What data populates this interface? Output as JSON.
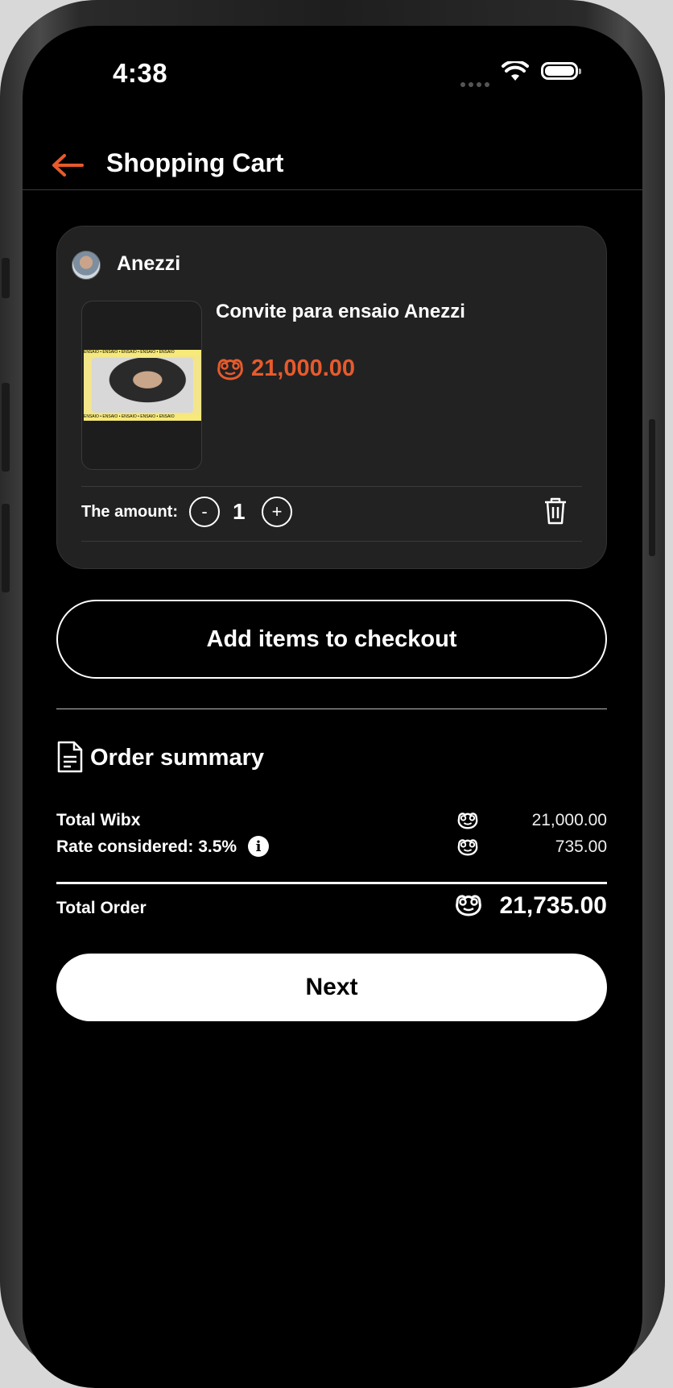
{
  "status_bar": {
    "time": "4:38"
  },
  "header": {
    "title": "Shopping Cart"
  },
  "cart": {
    "seller": "Anezzi",
    "product_title": "Convite para ensaio Anezzi",
    "thumb_band_text": "ENSAIO • ENSAIO • ENSAIO • ENSAIO • ENSAIO",
    "price": "21,000.00",
    "amount_label": "The amount:",
    "minus_label": "-",
    "plus_label": "+",
    "quantity": "1"
  },
  "add_items_label": "Add items to checkout",
  "summary": {
    "title": "Order summary",
    "rows": [
      {
        "label": "Total Wibx",
        "value": "21,000.00"
      },
      {
        "label": "Rate considered: 3.5%",
        "value": "735.00"
      }
    ],
    "total_label": "Total Order",
    "total_value": "21,735.00"
  },
  "next_label": "Next",
  "colors": {
    "accent": "#e85a2c",
    "background": "#000000",
    "card": "#222222"
  }
}
